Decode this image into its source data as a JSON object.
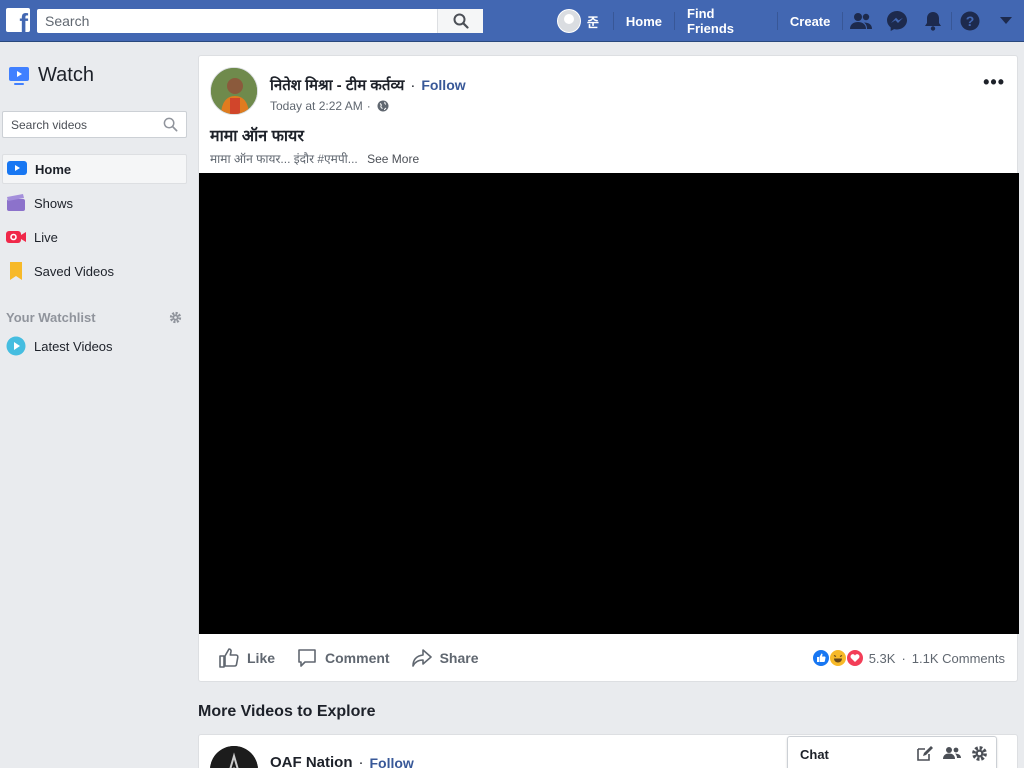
{
  "topbar": {
    "logo_letter": "f",
    "search_placeholder": "Search",
    "user_name": "준",
    "links": [
      "Home",
      "Find Friends",
      "Create"
    ],
    "icons": [
      "friends-icon",
      "messenger-icon",
      "notifications-icon",
      "help-icon",
      "account-menu-icon"
    ],
    "brand_color": "#4267b2"
  },
  "sidebar": {
    "title": "Watch",
    "search_placeholder": "Search videos",
    "items": [
      {
        "label": "Home",
        "icon": "watch-home-icon",
        "active": true
      },
      {
        "label": "Shows",
        "icon": "shows-icon"
      },
      {
        "label": "Live",
        "icon": "live-icon"
      },
      {
        "label": "Saved Videos",
        "icon": "saved-icon"
      }
    ],
    "watchlist_title": "Your Watchlist",
    "watchlist_items": [
      {
        "label": "Latest Videos",
        "icon": "latest-videos-icon"
      }
    ]
  },
  "post": {
    "author": "नितेश मिश्रा - टीम कर्तव्य",
    "follow": "Follow",
    "time": "Today at 2:22 AM",
    "title": "मामा ऑन फायर",
    "description": "मामा ऑन फायर... इंदौर #एमपी...",
    "see_more": "See More",
    "actions": [
      "Like",
      "Comment",
      "Share"
    ],
    "reactions_count": "5.3K",
    "comments_count": "1.1K Comments",
    "more_menu": "•••"
  },
  "more_section": {
    "title": "More Videos to Explore",
    "next_author": "OAF Nation",
    "next_follow": "Follow"
  },
  "chat": {
    "title": "Chat"
  }
}
